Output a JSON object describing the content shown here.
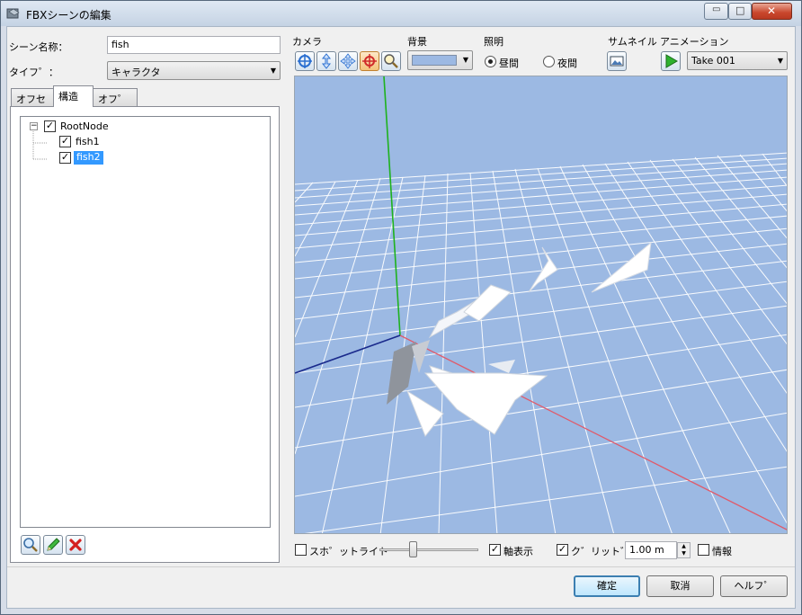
{
  "window": {
    "title": "FBXシーンの編集",
    "controls": {
      "minimize": "▭",
      "maximize": "□",
      "close": "✕"
    }
  },
  "form": {
    "scene_name_label": "シーン名称：",
    "scene_name_value": "fish",
    "type_label": "タイフ゜：",
    "type_value": "キャラクタ"
  },
  "tabs": [
    {
      "label": "オフセット",
      "active": false
    },
    {
      "label": "構造",
      "active": true
    },
    {
      "label": "オフ゜ション",
      "active": false
    }
  ],
  "tree": {
    "root": {
      "label": "RootNode",
      "checked": true,
      "expander": "−"
    },
    "children": [
      {
        "label": "fish1",
        "checked": true,
        "selected": false
      },
      {
        "label": "fish2",
        "checked": true,
        "selected": true
      }
    ]
  },
  "tree_buttons": {
    "search_icon": "magnifier-icon",
    "edit_icon": "pencil-icon",
    "delete_icon": "red-x-icon"
  },
  "toolbar": {
    "camera_label": "カメラ",
    "camera_buttons": [
      "rotate-icon",
      "pan-vertical-icon",
      "move-icon",
      "orbit-icon",
      "zoom-icon"
    ],
    "background_label": "背景",
    "background_color": "#9cb9e3",
    "lighting_label": "照明",
    "lighting_options": [
      {
        "label": "昼間",
        "selected": true
      },
      {
        "label": "夜間",
        "selected": false
      }
    ],
    "thumbnail_label": "サムネイル",
    "animation_label": "アニメーション",
    "animation_value": "Take 001"
  },
  "viewport": {
    "background": "#9cb9e3",
    "grid_color": "#ffffff",
    "axis_y_color": "#1fb21f",
    "axis_x_color": "#e05a6a",
    "axis_z_color": "#1a2a8c"
  },
  "bottom_bar": {
    "spotlight_label": "スホ゜ットライト",
    "spotlight_checked": false,
    "axis_label": "軸表示",
    "axis_checked": true,
    "grid_label": "ク゛リット゛表示",
    "grid_checked": true,
    "grid_size_value": "1.00 m",
    "info_label": "情報",
    "info_checked": false
  },
  "dialog_buttons": {
    "ok": "確定",
    "cancel": "取消",
    "help": "ヘルフ゜"
  },
  "colors": {
    "selection": "#3399ff",
    "window_frame": "#d6dde8"
  }
}
